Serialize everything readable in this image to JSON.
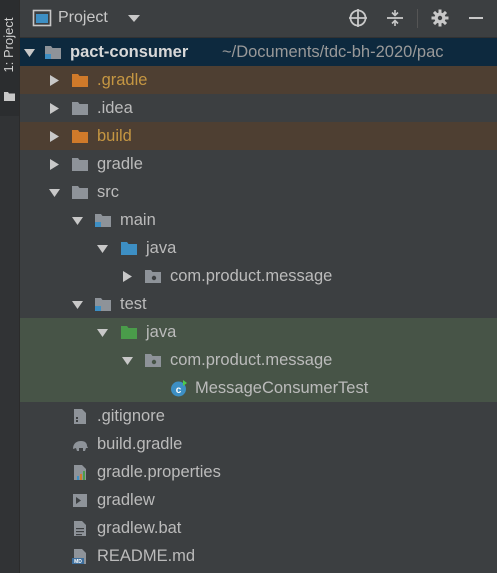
{
  "sidebar": {
    "tab_label": "1: Project"
  },
  "header": {
    "title": "Project",
    "icons": [
      "project-view-icon",
      "dropdown-arrow-icon",
      "locate-icon",
      "collapse-all-icon",
      "settings-icon",
      "hide-icon"
    ]
  },
  "tree": {
    "root": {
      "label": "pact-consumer",
      "path": "~/Documents/tdc-bh-2020/pac"
    },
    "gradle_hidden": ".gradle",
    "idea": ".idea",
    "build": "build",
    "gradle": "gradle",
    "src": "src",
    "main": "main",
    "main_java": "java",
    "main_package": "com.product.message",
    "test": "test",
    "test_java": "java",
    "test_package": "com.product.message",
    "test_class": "MessageConsumerTest",
    "gitignore": ".gitignore",
    "build_gradle": "build.gradle",
    "gradle_properties": "gradle.properties",
    "gradlew": "gradlew",
    "gradlew_bat": "gradlew.bat",
    "readme": "README.md",
    "readme_badge": "MD"
  },
  "colors": {
    "background": "#3c3f41",
    "selected_row": "#0d293e",
    "excluded_row": "#4e3f32",
    "test_row": "#475447",
    "excluded_text": "#c59642",
    "folder_gray": "#8e9399",
    "source_folder_blue": "#3d8fc4",
    "test_folder_green": "#4a9c4a",
    "excluded_folder_orange": "#d07a2a"
  }
}
